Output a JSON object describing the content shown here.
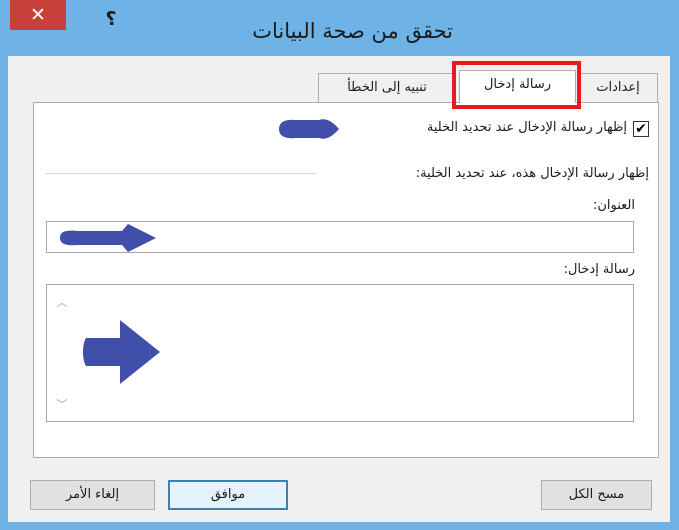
{
  "window": {
    "title": "تحقق من صحة البيانات",
    "close_glyph": "✕",
    "help_glyph": "؟"
  },
  "tabs": [
    {
      "label": "إعدادات",
      "active": false
    },
    {
      "label": "رسالة إدخال",
      "active": true
    },
    {
      "label": "تنبيه إلى الخطأ",
      "active": false
    }
  ],
  "input_message": {
    "show_checkbox_label": "إظهار رسالة الإدخال عند تحديد الخلية",
    "show_checked": true,
    "checkmark": "✔",
    "section_label": "إظهار رسالة الإدخال هذه، عند تحديد الخلية:",
    "title_label": "العنوان:",
    "title_value": "",
    "message_label": "رسالة إدخال:",
    "message_value": ""
  },
  "buttons": {
    "clear_all": "مسح الكل",
    "ok": "موافق",
    "cancel": "إلغاء الأمر"
  },
  "colors": {
    "highlight": "#e8191f",
    "titlebar": "#6fb2e6",
    "close": "#c7403a",
    "annotation_arrow": "#3f4faa"
  }
}
